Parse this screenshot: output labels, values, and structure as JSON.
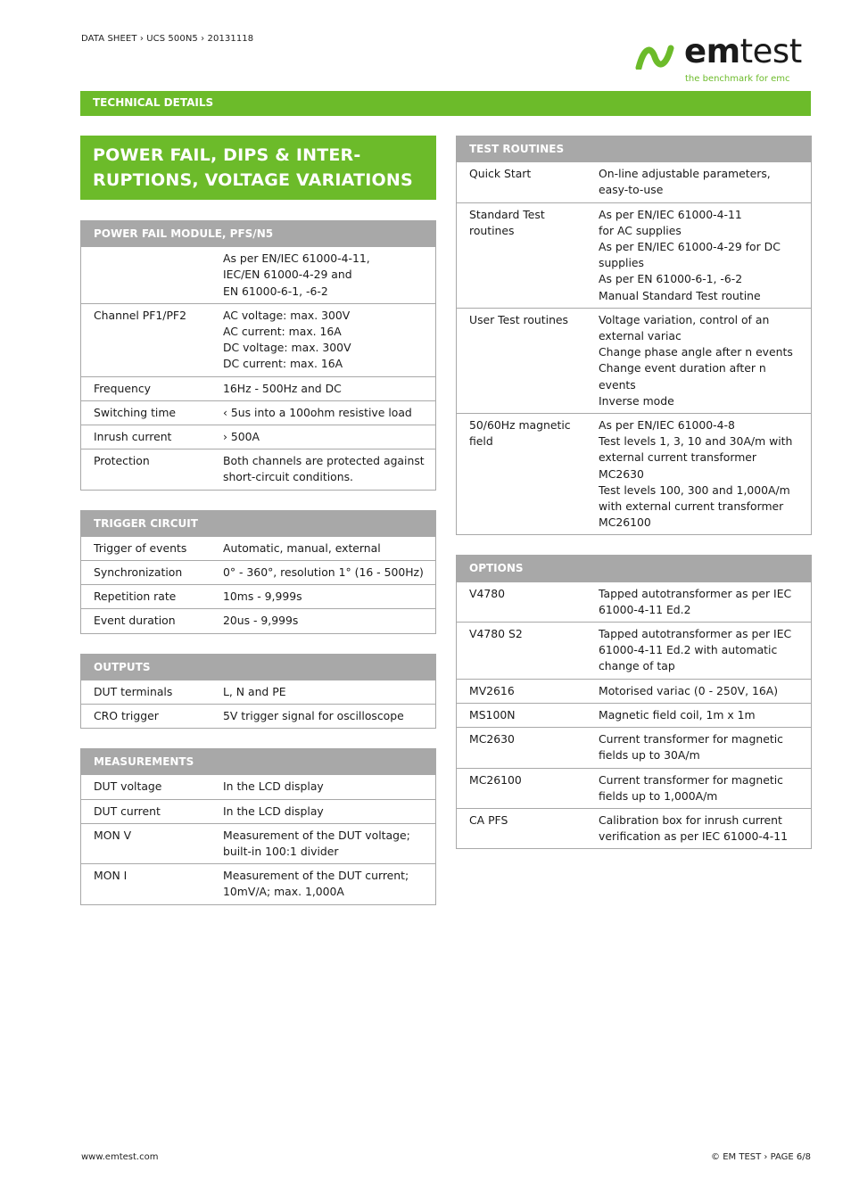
{
  "header": {
    "breadcrumb": "DATA SHEET › UCS 500N5 › 20131118",
    "logo": {
      "word_bold": "em",
      "word_thin": "test",
      "tagline": "the benchmark for emc",
      "brand_color": "#6cbb2a"
    },
    "section_bar": "TECHNICAL DETAILS"
  },
  "title": "POWER FAIL, DIPS & INTER-\nRUPTIONS, VOLTAGE VARIATIONS",
  "left_tables": [
    {
      "heading": "POWER FAIL MODULE, PFS/N5",
      "rows": [
        {
          "k": "",
          "v": "As per EN/IEC 61000-4-11,\nIEC/EN 61000-4-29 and\nEN 61000-6-1, -6-2"
        },
        {
          "k": "Channel PF1/PF2",
          "v": "AC voltage: max. 300V\nAC current: max. 16A\nDC voltage: max. 300V\nDC current: max. 16A"
        },
        {
          "k": "Frequency",
          "v": "16Hz - 500Hz and DC"
        },
        {
          "k": "Switching time",
          "v": "‹ 5us into a 100ohm resistive load"
        },
        {
          "k": "Inrush current",
          "v": "› 500A"
        },
        {
          "k": "Protection",
          "v": "Both channels are protected against\nshort-circuit conditions."
        }
      ]
    },
    {
      "heading": "TRIGGER CIRCUIT",
      "rows": [
        {
          "k": "Trigger of events",
          "v": "Automatic, manual, external"
        },
        {
          "k": "Synchronization",
          "v": "0° - 360°, resolution 1° (16 - 500Hz)"
        },
        {
          "k": "Repetition rate",
          "v": "10ms - 9,999s"
        },
        {
          "k": "Event duration",
          "v": "20us - 9,999s"
        }
      ]
    },
    {
      "heading": "OUTPUTS",
      "rows": [
        {
          "k": "DUT terminals",
          "v": "L, N and PE"
        },
        {
          "k": "CRO trigger",
          "v": "5V trigger signal for oscilloscope"
        }
      ]
    },
    {
      "heading": "MEASUREMENTS",
      "rows": [
        {
          "k": "DUT voltage",
          "v": "In the LCD display"
        },
        {
          "k": "DUT current",
          "v": "In the LCD display"
        },
        {
          "k": "MON V",
          "v": "Measurement of the DUT voltage;\nbuilt-in 100:1 divider"
        },
        {
          "k": "MON I",
          "v": "Measurement of the DUT current;\n10mV/A; max. 1,000A"
        }
      ]
    }
  ],
  "right_tables": [
    {
      "heading": "TEST ROUTINES",
      "rows": [
        {
          "k": "Quick Start",
          "v": "On-line adjustable parameters,\neasy-to-use"
        },
        {
          "k": "Standard Test\nroutines",
          "v": "As per EN/IEC 61000-4-11\nfor AC supplies\nAs per EN/IEC 61000-4-29 for DC\nsupplies\nAs per EN 61000-6-1, -6-2\nManual Standard Test routine"
        },
        {
          "k": "User Test routines",
          "v": "Voltage variation, control of an\nexternal variac\nChange phase angle after n events\nChange event duration after n\nevents\nInverse mode"
        },
        {
          "k": "50/60Hz magnetic\nfield",
          "v": "As per EN/IEC 61000-4-8\nTest levels 1, 3, 10 and 30A/m with\nexternal current transformer\nMC2630\nTest levels 100, 300 and 1,000A/m\nwith external current transformer\nMC26100"
        }
      ]
    },
    {
      "heading": "OPTIONS",
      "rows": [
        {
          "k": "V4780",
          "v": "Tapped autotransformer as per IEC\n61000-4-11 Ed.2"
        },
        {
          "k": "V4780 S2",
          "v": "Tapped autotransformer as per IEC\n61000-4-11 Ed.2 with automatic\nchange of tap"
        },
        {
          "k": "MV2616",
          "v": "Motorised variac (0 - 250V, 16A)"
        },
        {
          "k": "MS100N",
          "v": "Magnetic field coil, 1m x 1m"
        },
        {
          "k": "MC2630",
          "v": "Current transformer for magnetic\nfields up to 30A/m"
        },
        {
          "k": "MC26100",
          "v": "Current transformer for magnetic\nfields up to 1,000A/m"
        },
        {
          "k": "CA PFS",
          "v": "Calibration box for inrush current\nverification as per IEC 61000-4-11"
        }
      ]
    }
  ],
  "footer": {
    "website": "www.emtest.com",
    "page_info": "© EM TEST › PAGE 6/8"
  }
}
